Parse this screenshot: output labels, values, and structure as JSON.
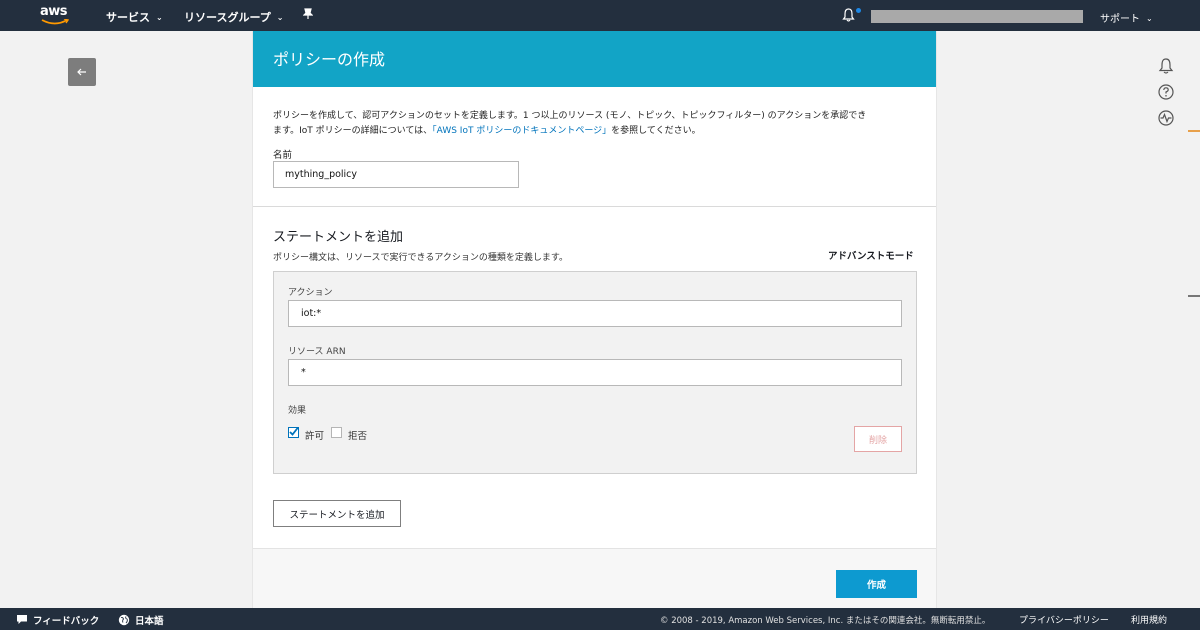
{
  "topnav": {
    "logo": "aws",
    "services_label": "サービス",
    "resource_groups_label": "リソースグループ",
    "support_label": "サポート",
    "icons": [
      "chevron-down-icon",
      "pin-icon",
      "bell-icon"
    ]
  },
  "page": {
    "title": "ポリシーの作成",
    "intro_line1": "ポリシーを作成して、認可アクションのセットを定義します。1 つ以上のリソース (モノ、トピック、トピックフィルター) のアクションを承認でき",
    "intro_line2_pre": "ます。IoT ポリシーの詳細については、",
    "intro_link": "「AWS IoT ポリシーのドキュメントページ」",
    "intro_line2_post": "を参照してください。",
    "name_label": "名前",
    "name_value": "mything_policy"
  },
  "statement": {
    "title": "ステートメントを追加",
    "description": "ポリシー構文は、リソースで実行できるアクションの種類を定義します。",
    "advanced_mode": "アドバンストモード",
    "action_label": "アクション",
    "action_value": "iot:*",
    "resource_label": "リソース ARN",
    "resource_value": "*",
    "effect_label": "効果",
    "allow_label": "許可",
    "allow_checked": true,
    "deny_label": "拒否",
    "deny_checked": false,
    "delete_label": "削除",
    "add_statement_label": "ステートメントを追加"
  },
  "actions": {
    "create_label": "作成"
  },
  "footer": {
    "feedback": "フィードバック",
    "language": "日本語",
    "copyright": "© 2008 - 2019, Amazon Web Services, Inc. またはその関連会社。無断転用禁止。",
    "privacy": "プライバシーポリシー",
    "terms": "利用規約"
  },
  "colors": {
    "nav_bg": "#232f3e",
    "header_bg": "#12a4c6",
    "primary_button": "#0d9ad0",
    "link": "#0073bb",
    "delete_disabled": "#e4a5a5"
  }
}
